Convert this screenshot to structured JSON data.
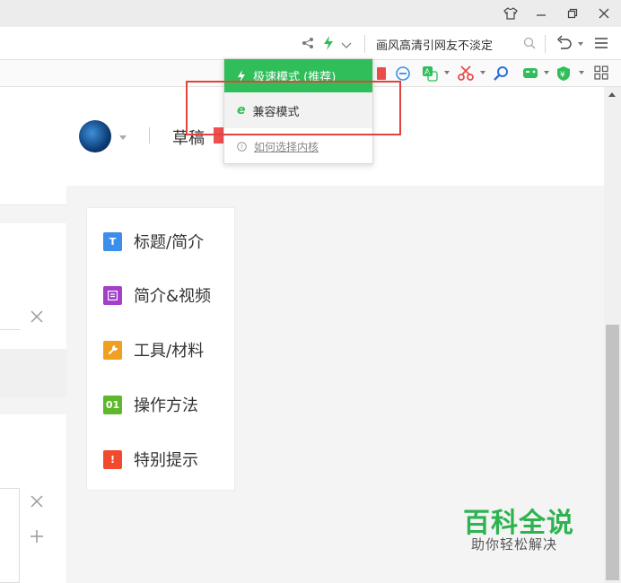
{
  "addressbar": {
    "search_text": "画风高清引网友不淡定"
  },
  "engine_menu": {
    "speed_mode": "极速模式 (推荐)",
    "compat_mode": "兼容模式",
    "help_link": "如何选择内核"
  },
  "page": {
    "draft_label": "草稿"
  },
  "side_menu": {
    "items": [
      {
        "badge": "T",
        "label": "标题/简介",
        "color": "#3b8eea",
        "icon": "title-icon"
      },
      {
        "badge": "",
        "label": "简介&视频",
        "color": "#a33fc9",
        "icon": "intro-video-icon"
      },
      {
        "badge": "",
        "label": "工具/材料",
        "color": "#f0a020",
        "icon": "wrench-icon"
      },
      {
        "badge": "01",
        "label": "操作方法",
        "color": "#5fb82b",
        "icon": "steps-icon"
      },
      {
        "badge": "!",
        "label": "特别提示",
        "color": "#f04b2e",
        "icon": "warning-icon"
      }
    ]
  },
  "watermark": {
    "title": "百科全说",
    "subtitle": "助你轻松解决"
  },
  "colors": {
    "accent_green": "#2fbe5a",
    "highlight_red": "#e0443c"
  }
}
